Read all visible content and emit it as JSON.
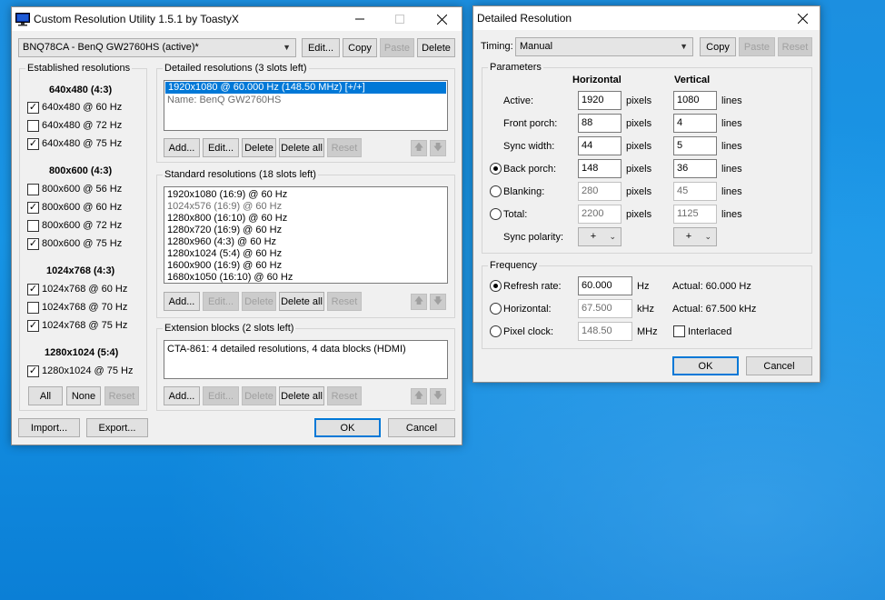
{
  "colors": {
    "accent": "#0078d7",
    "desktop": "#1795e6"
  },
  "cru": {
    "title": "Custom Resolution Utility 1.5.1 by ToastyX",
    "monitor": "BNQ78CA - BenQ GW2760HS (active)*",
    "top_buttons": {
      "edit": "Edit...",
      "copy": "Copy",
      "paste": "Paste",
      "delete": "Delete"
    },
    "established": {
      "label": "Established resolutions",
      "groups": [
        {
          "header": "640x480 (4:3)",
          "items": [
            {
              "label": "640x480 @ 60 Hz",
              "checked": true
            },
            {
              "label": "640x480 @ 72 Hz",
              "checked": false
            },
            {
              "label": "640x480 @ 75 Hz",
              "checked": true
            }
          ]
        },
        {
          "header": "800x600 (4:3)",
          "items": [
            {
              "label": "800x600 @ 56 Hz",
              "checked": false
            },
            {
              "label": "800x600 @ 60 Hz",
              "checked": true
            },
            {
              "label": "800x600 @ 72 Hz",
              "checked": false
            },
            {
              "label": "800x600 @ 75 Hz",
              "checked": true
            }
          ]
        },
        {
          "header": "1024x768 (4:3)",
          "items": [
            {
              "label": "1024x768 @ 60 Hz",
              "checked": true
            },
            {
              "label": "1024x768 @ 70 Hz",
              "checked": false
            },
            {
              "label": "1024x768 @ 75 Hz",
              "checked": true
            }
          ]
        },
        {
          "header": "1280x1024 (5:4)",
          "items": [
            {
              "label": "1280x1024 @ 75 Hz",
              "checked": true
            }
          ]
        }
      ],
      "buttons": {
        "all": "All",
        "none": "None",
        "reset": "Reset"
      }
    },
    "detailed": {
      "label": "Detailed resolutions (3 slots left)",
      "items": [
        {
          "text": "1920x1080 @ 60.000 Hz (148.50 MHz) [+/+]",
          "style": "sel"
        },
        {
          "text": "Name: BenQ GW2760HS",
          "style": "gray"
        }
      ]
    },
    "standard": {
      "label": "Standard resolutions (18 slots left)",
      "items": [
        {
          "text": "1920x1080 (16:9) @ 60 Hz",
          "style": ""
        },
        {
          "text": "1024x576 (16:9) @ 60 Hz",
          "style": "gray"
        },
        {
          "text": "1280x800 (16:10) @ 60 Hz",
          "style": ""
        },
        {
          "text": "1280x720 (16:9) @ 60 Hz",
          "style": ""
        },
        {
          "text": "1280x960 (4:3) @ 60 Hz",
          "style": ""
        },
        {
          "text": "1280x1024 (5:4) @ 60 Hz",
          "style": ""
        },
        {
          "text": "1600x900 (16:9) @ 60 Hz",
          "style": ""
        },
        {
          "text": "1680x1050 (16:10) @ 60 Hz",
          "style": ""
        }
      ]
    },
    "extension": {
      "label": "Extension blocks (2 slots left)",
      "items": [
        {
          "text": "CTA-861: 4 detailed resolutions, 4 data blocks (HDMI)",
          "style": ""
        }
      ]
    },
    "list_buttons": {
      "add": "Add...",
      "edit": "Edit...",
      "delete": "Delete",
      "delete_all": "Delete all",
      "reset": "Reset"
    },
    "bottom": {
      "import": "Import...",
      "export": "Export...",
      "ok": "OK",
      "cancel": "Cancel"
    }
  },
  "detail": {
    "title": "Detailed Resolution",
    "timing_label": "Timing:",
    "timing_value": "Manual",
    "timing_buttons": {
      "copy": "Copy",
      "paste": "Paste",
      "reset": "Reset"
    },
    "parameters_label": "Parameters",
    "col_h": "Horizontal",
    "col_v": "Vertical",
    "rows": [
      {
        "label": "Active:",
        "h": "1920",
        "v": "1080",
        "ro": false,
        "radio": null
      },
      {
        "label": "Front porch:",
        "h": "88",
        "v": "4",
        "ro": false,
        "radio": null
      },
      {
        "label": "Sync width:",
        "h": "44",
        "v": "5",
        "ro": false,
        "radio": null
      },
      {
        "label": "Back porch:",
        "h": "148",
        "v": "36",
        "ro": false,
        "radio": "on"
      },
      {
        "label": "Blanking:",
        "h": "280",
        "v": "45",
        "ro": true,
        "radio": "off"
      },
      {
        "label": "Total:",
        "h": "2200",
        "v": "1125",
        "ro": true,
        "radio": "off"
      }
    ],
    "unit_h": "pixels",
    "unit_v": "lines",
    "sync_polarity_label": "Sync polarity:",
    "sync_h": "+",
    "sync_v": "+",
    "frequency_label": "Frequency",
    "freq_rows": [
      {
        "label": "Refresh rate:",
        "value": "60.000",
        "unit": "Hz",
        "actual": "Actual: 60.000 Hz",
        "radio": "on",
        "ro": false
      },
      {
        "label": "Horizontal:",
        "value": "67.500",
        "unit": "kHz",
        "actual": "Actual: 67.500 kHz",
        "radio": "off",
        "ro": true
      },
      {
        "label": "Pixel clock:",
        "value": "148.50",
        "unit": "MHz",
        "actual": "",
        "radio": "off",
        "ro": true
      }
    ],
    "interlaced_label": "Interlaced",
    "ok": "OK",
    "cancel": "Cancel"
  }
}
